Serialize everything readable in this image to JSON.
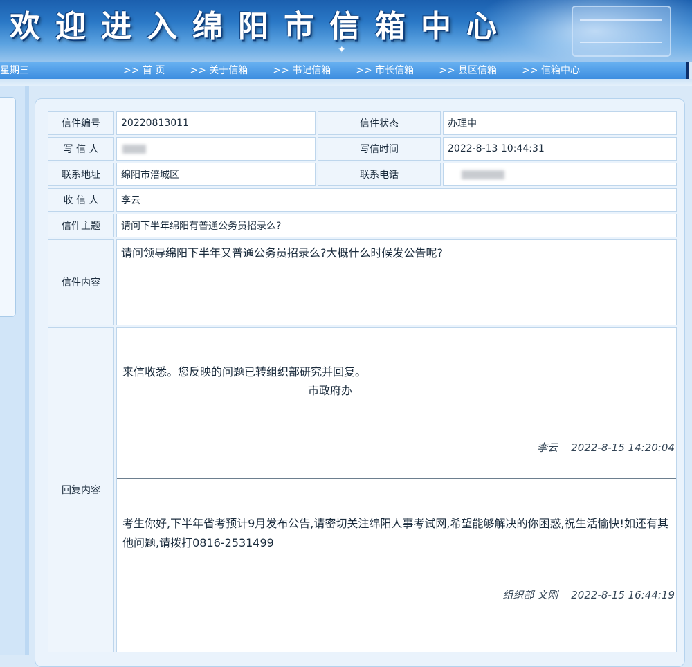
{
  "header": {
    "title": "欢迎进入绵阳市信箱中心"
  },
  "nav": {
    "date": "星期三",
    "items": [
      ">> 首 页",
      ">> 关于信箱",
      ">> 书记信箱",
      ">> 市长信箱",
      ">> 县区信箱",
      ">> 信箱中心"
    ]
  },
  "letter": {
    "number_label": "信件编号",
    "number": "20220813011",
    "status_label": "信件状态",
    "status": "办理中",
    "writer_label": "写 信 人",
    "time_label": "写信时间",
    "time": "2022-8-13 10:44:31",
    "address_label": "联系地址",
    "address": "绵阳市涪城区",
    "phone_label": "联系电话",
    "recipient_label": "收 信 人",
    "recipient": "李云",
    "subject_label": "信件主题",
    "subject": "请问下半年绵阳有普通公务员招录么?",
    "content_label": "信件内容",
    "content": "请问领导绵阳下半年又普通公务员招录么?大概什么时候发公告呢?",
    "reply_label": "回复内容"
  },
  "replies": [
    {
      "body": "来信收悉。您反映的问题已转组织部研究并回复。",
      "sign": "市政府办",
      "author": "李云",
      "datetime": "2022-8-15 14:20:04"
    },
    {
      "body": "考生你好,下半年省考预计9月发布公告,请密切关注绵阳人事考试网,希望能够解决的你困惑,祝生活愉快!如还有其他问题,请拨打0816-2531499",
      "author": "组织部 文刚",
      "datetime": "2022-8-15 16:44:19"
    }
  ]
}
